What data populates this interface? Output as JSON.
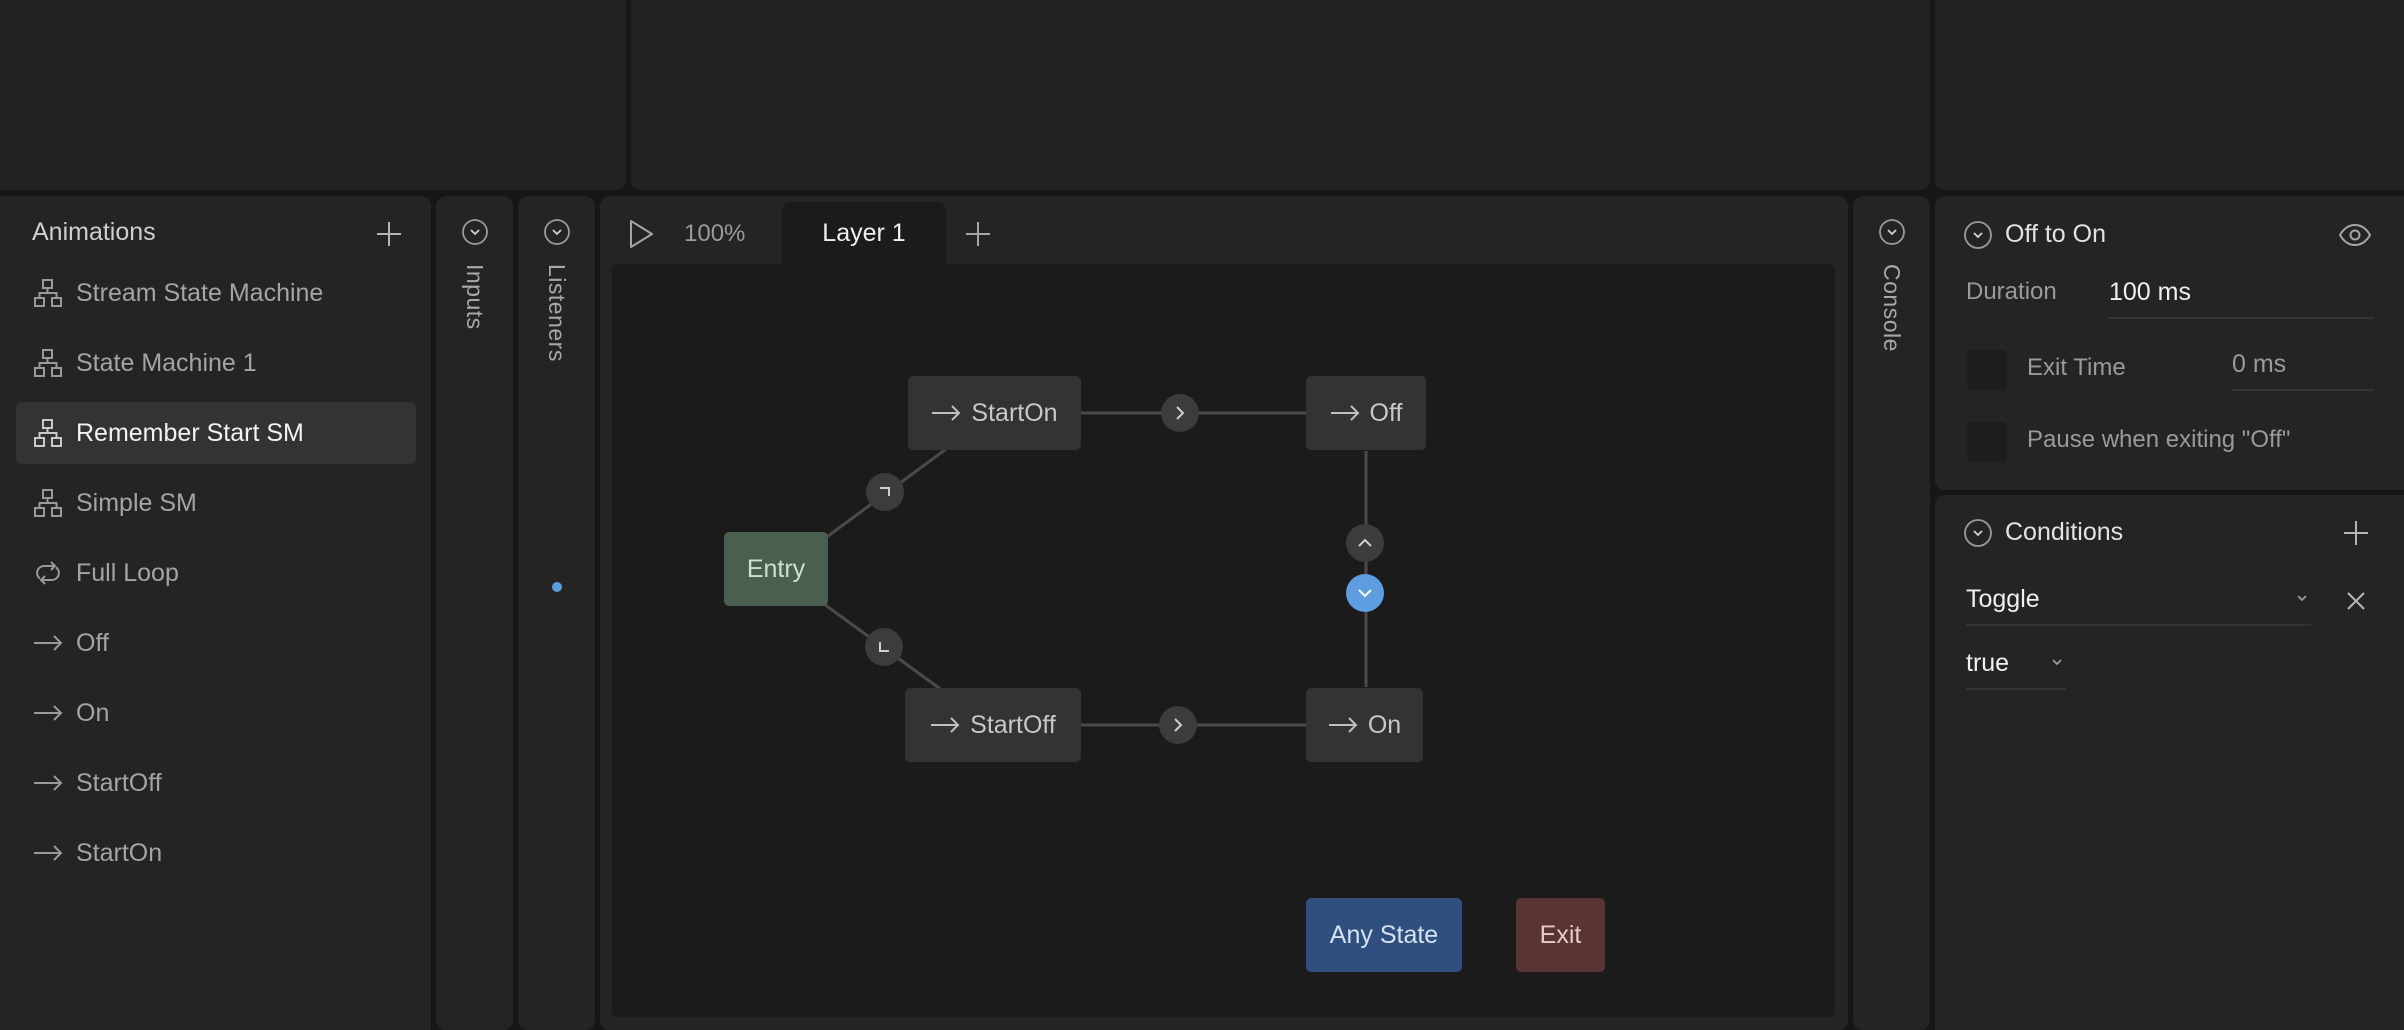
{
  "animations": {
    "title": "Animations",
    "items": [
      {
        "icon": "state-machine-icon",
        "label": "Stream State Machine"
      },
      {
        "icon": "state-machine-icon",
        "label": "State Machine 1"
      },
      {
        "icon": "state-machine-icon",
        "label": "Remember Start SM",
        "selected": true
      },
      {
        "icon": "state-machine-icon",
        "label": "Simple SM"
      },
      {
        "icon": "loop-icon",
        "label": "Full Loop"
      },
      {
        "icon": "one-shot-arrow-icon",
        "label": "Off"
      },
      {
        "icon": "one-shot-arrow-icon",
        "label": "On"
      },
      {
        "icon": "one-shot-arrow-icon",
        "label": "StartOff"
      },
      {
        "icon": "one-shot-arrow-icon",
        "label": "StartOn"
      }
    ]
  },
  "side_panels": {
    "inputs": "Inputs",
    "listeners": "Listeners",
    "console": "Console"
  },
  "canvas_header": {
    "zoom": "100%",
    "tab": "Layer 1"
  },
  "graph": {
    "states": {
      "entry": "Entry",
      "start_on": "StartOn",
      "off": "Off",
      "start_off": "StartOff",
      "on": "On",
      "any_state": "Any State",
      "exit": "Exit"
    }
  },
  "transition": {
    "title": "Off to On",
    "duration_label": "Duration",
    "duration_value": "100 ms",
    "exit_time_label": "Exit Time",
    "exit_time_value": "0 ms",
    "pause_label": "Pause when exiting \"Off\""
  },
  "conditions": {
    "title": "Conditions",
    "input": "Toggle",
    "value": "true"
  },
  "colors": {
    "entry": "#4b5f51",
    "any_state": "#2f4f7f",
    "exit": "#5a3333",
    "active_transition": "#5d9de0"
  }
}
